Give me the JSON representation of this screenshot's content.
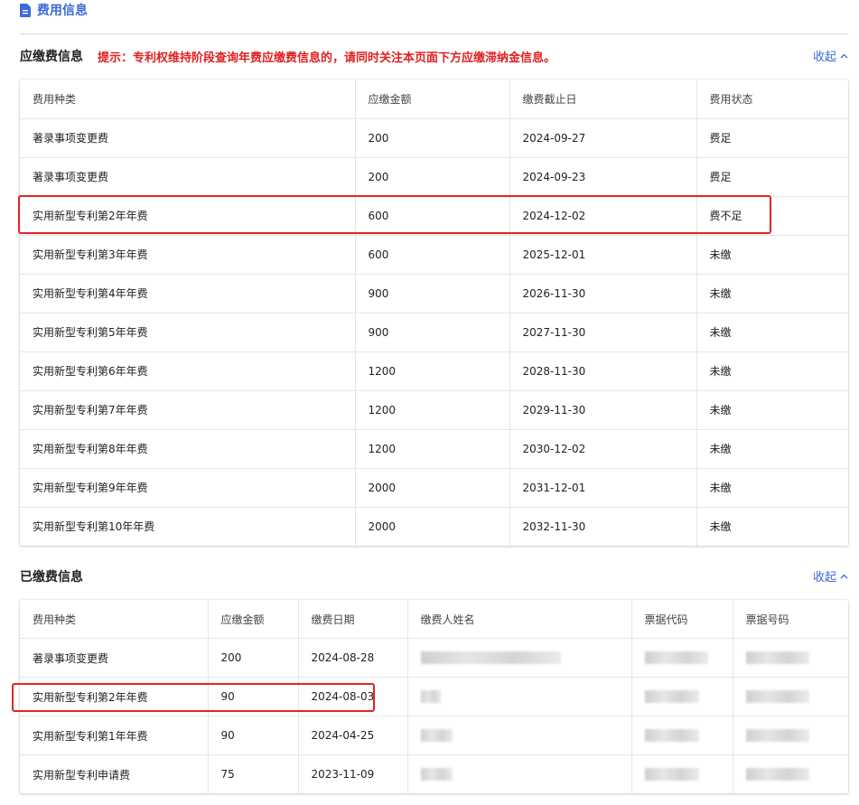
{
  "header": {
    "title": "费用信息",
    "icon": "document-icon"
  },
  "due_section": {
    "title": "应缴费信息",
    "tip": "提示：专利权维持阶段查询年费应缴费信息的，请同时关注本页面下方应缴滞纳金信息。",
    "collapse_label": "收起",
    "columns": [
      "费用种类",
      "应缴金额",
      "缴费截止日",
      "费用状态"
    ],
    "rows": [
      [
        "著录事项变更费",
        "200",
        "2024-09-27",
        "费足"
      ],
      [
        "著录事项变更费",
        "200",
        "2024-09-23",
        "费足"
      ],
      [
        "实用新型专利第2年年费",
        "600",
        "2024-12-02",
        "费不足"
      ],
      [
        "实用新型专利第3年年费",
        "600",
        "2025-12-01",
        "未缴"
      ],
      [
        "实用新型专利第4年年费",
        "900",
        "2026-11-30",
        "未缴"
      ],
      [
        "实用新型专利第5年年费",
        "900",
        "2027-11-30",
        "未缴"
      ],
      [
        "实用新型专利第6年年费",
        "1200",
        "2028-11-30",
        "未缴"
      ],
      [
        "实用新型专利第7年年费",
        "1200",
        "2029-11-30",
        "未缴"
      ],
      [
        "实用新型专利第8年年费",
        "1200",
        "2030-12-02",
        "未缴"
      ],
      [
        "实用新型专利第9年年费",
        "2000",
        "2031-12-01",
        "未缴"
      ],
      [
        "实用新型专利第10年年费",
        "2000",
        "2032-11-30",
        "未缴"
      ]
    ]
  },
  "paid_section": {
    "title": "已缴费信息",
    "collapse_label": "收起",
    "columns": [
      "费用种类",
      "应缴金额",
      "缴费日期",
      "缴费人姓名",
      "票据代码",
      "票据号码"
    ],
    "rows": [
      [
        "著录事项变更费",
        "200",
        "2024-08-28"
      ],
      [
        "实用新型专利第2年年费",
        "90",
        "2024-08-03"
      ],
      [
        "实用新型专利第1年年费",
        "90",
        "2024-04-25"
      ],
      [
        "实用新型专利申请费",
        "75",
        "2023-11-09"
      ]
    ]
  },
  "colors": {
    "accent": "#3b6bd6",
    "alert": "#e02020",
    "highlight_border": "#e52222"
  }
}
